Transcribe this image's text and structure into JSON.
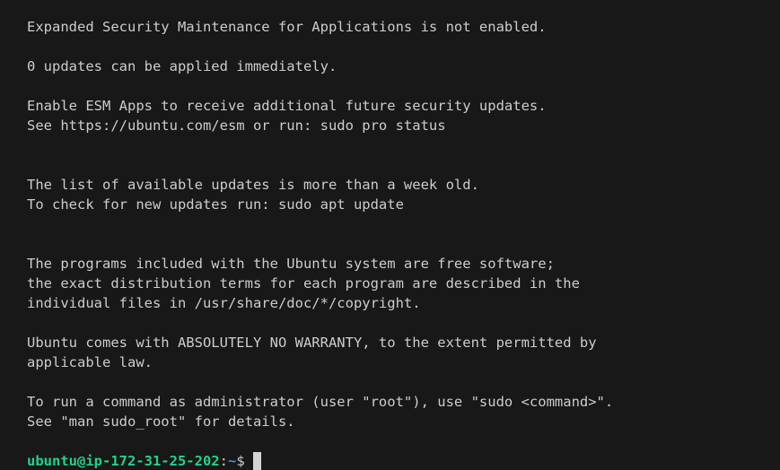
{
  "terminal": {
    "lines": [
      "Expanded Security Maintenance for Applications is not enabled.",
      "",
      "0 updates can be applied immediately.",
      "",
      "Enable ESM Apps to receive additional future security updates.",
      "See https://ubuntu.com/esm or run: sudo pro status",
      "",
      "",
      "The list of available updates is more than a week old.",
      "To check for new updates run: sudo apt update",
      "",
      "",
      "The programs included with the Ubuntu system are free software;",
      "the exact distribution terms for each program are described in the",
      "individual files in /usr/share/doc/*/copyright.",
      "",
      "Ubuntu comes with ABSOLUTELY NO WARRANTY, to the extent permitted by",
      "applicable law.",
      "",
      "To run a command as administrator (user \"root\"), use \"sudo <command>\".",
      "See \"man sudo_root\" for details.",
      ""
    ],
    "prompt": {
      "user_host": "ubuntu@ip-172-31-25-202",
      "colon": ":",
      "path": "~",
      "symbol": "$"
    },
    "colors": {
      "background": "#181818",
      "text": "#cccccc",
      "user_host": "#23d18b",
      "path": "#3b8eea",
      "cursor": "#d4d4d4"
    }
  }
}
